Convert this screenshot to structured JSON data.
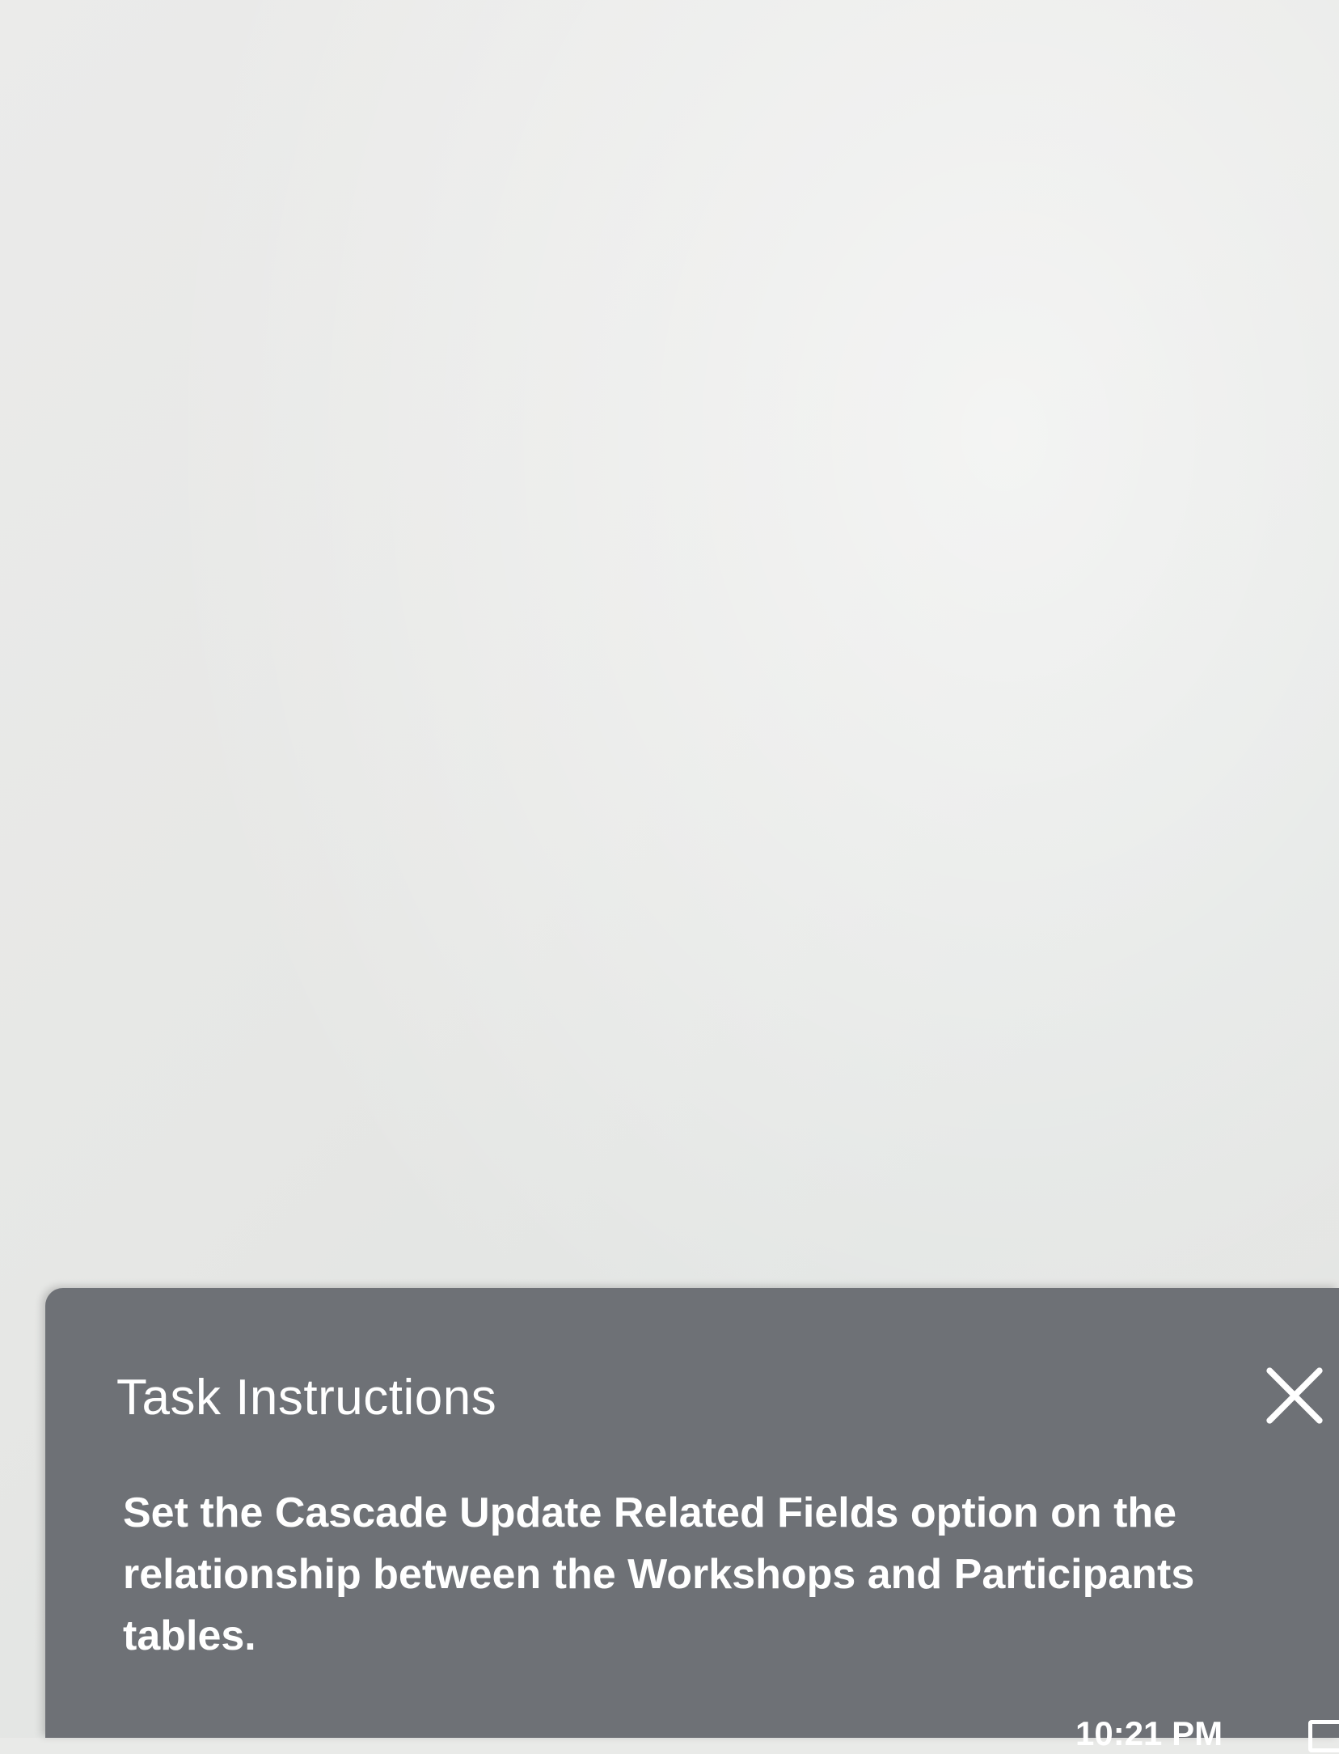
{
  "task_panel": {
    "title": "Task Instructions",
    "instruction": "Set the Cascade Update Related Fields option on the relationship between the Workshops and Participants tables.",
    "close_icon": "close-icon",
    "background_color": "#6e7176"
  },
  "taskbar": {
    "clock": "10:21 PM",
    "notification_icon": "notification-icon"
  }
}
